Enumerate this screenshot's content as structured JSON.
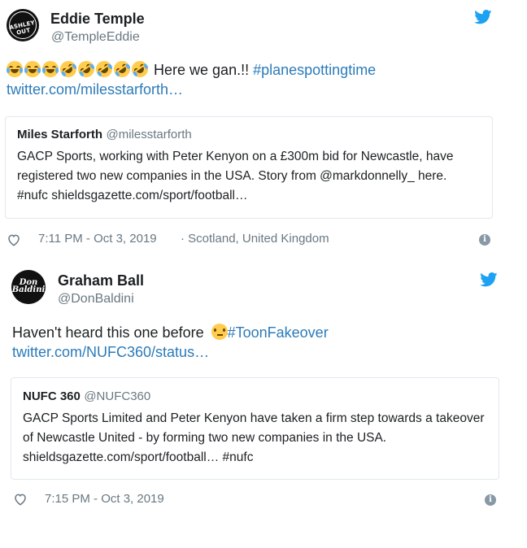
{
  "tweets": [
    {
      "avatar_text": "ASHLEY OUT",
      "name": "Eddie Temple",
      "handle": "@TempleEddie",
      "text": "Here we gan.!!",
      "hashtag": "#planespottingtime",
      "link": "twitter.com/milesstarforth…",
      "emojis": [
        "face-with-tears-of-joy",
        "face-with-tears-of-joy",
        "face-with-tears-of-joy",
        "rolling-on-the-floor-laughing",
        "rolling-on-the-floor-laughing",
        "rolling-on-the-floor-laughing",
        "rolling-on-the-floor-laughing",
        "rolling-on-the-floor-laughing"
      ],
      "quote": {
        "name": "Miles Starforth",
        "handle": "@milesstarforth",
        "text": "GACP Sports, working with Peter Kenyon on a £300m bid for Newcastle, have registered two new companies in the USA. Story from @markdonnelly_ here. #nufc shieldsgazette.com/sport/football…"
      },
      "time": "7:11 PM - Oct 3, 2019",
      "location": "· Scotland, United Kingdom"
    },
    {
      "avatar_text": "Don Baldini",
      "name": "Graham Ball",
      "handle": "@DonBaldini",
      "text": "Haven't heard this one before",
      "hashtag": "#ToonFakeover",
      "link": "twitter.com/NUFC360/status…",
      "emojis": [
        "thinking-face"
      ],
      "quote": {
        "name": "NUFC 360",
        "handle": "@NUFC360",
        "text": "GACP Sports Limited and Peter Kenyon have taken a firm step towards a takeover of Newcastle United - by forming two new companies in the USA. shieldsgazette.com/sport/football… #nufc"
      },
      "time": "7:15 PM - Oct 3, 2019"
    }
  ],
  "colors": {
    "link": "#2b7bb9",
    "twitter_blue": "#1da1f2",
    "muted": "#697882"
  }
}
